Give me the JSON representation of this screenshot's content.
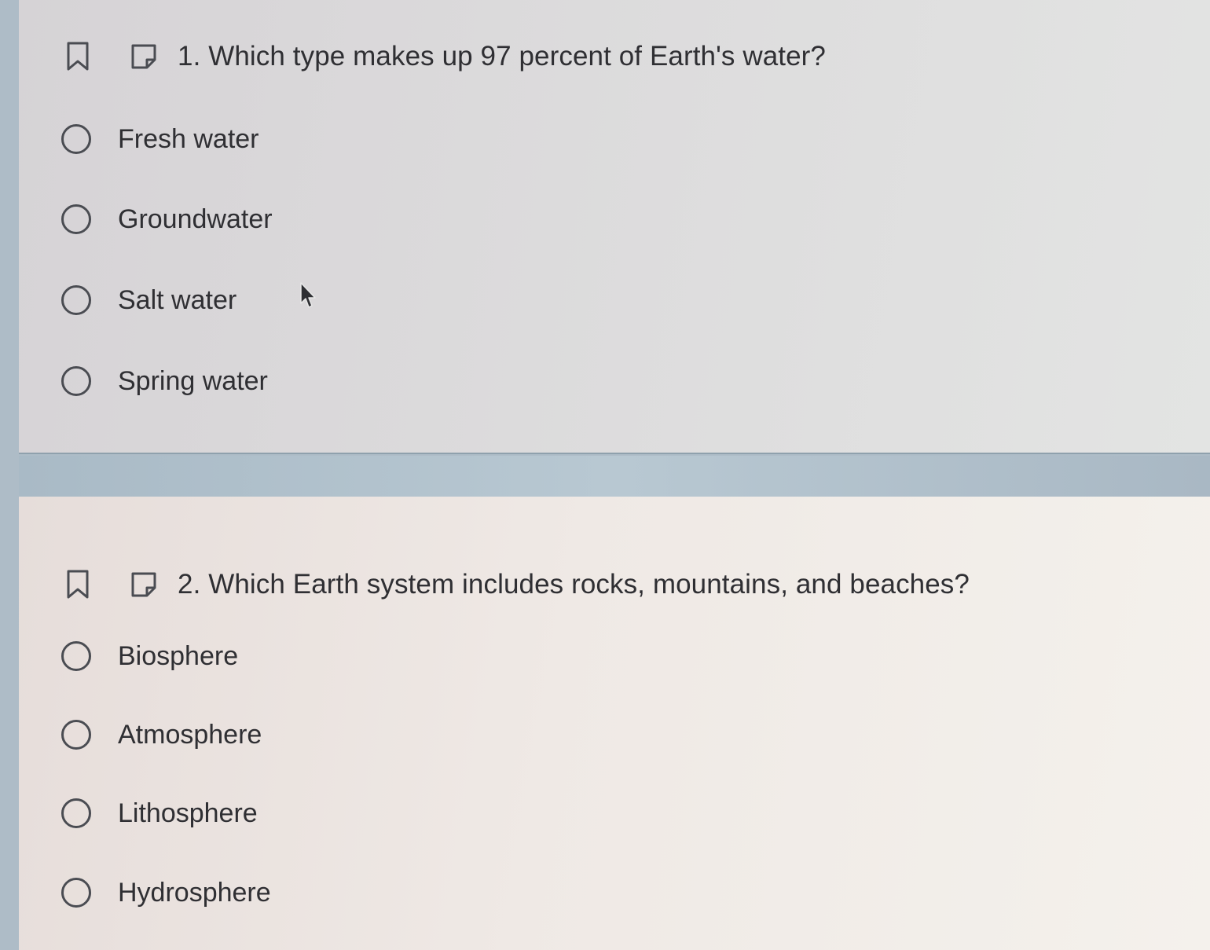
{
  "questions": [
    {
      "number_text": "1. Which type makes up 97 percent of Earth's water?",
      "options": [
        "Fresh water",
        "Groundwater",
        "Salt water",
        "Spring water"
      ]
    },
    {
      "number_text": "2. Which Earth system includes rocks, mountains, and beaches?",
      "options": [
        "Biosphere",
        "Atmosphere",
        "Lithosphere",
        "Hydrosphere"
      ]
    }
  ],
  "colors": {
    "radio_border": "#4a4c52",
    "text": "#2f2f33",
    "page_band": "#aebcc7"
  },
  "icons": {
    "bookmark": "bookmark-icon",
    "note": "note-icon",
    "cursor": "mouse-pointer-icon"
  }
}
